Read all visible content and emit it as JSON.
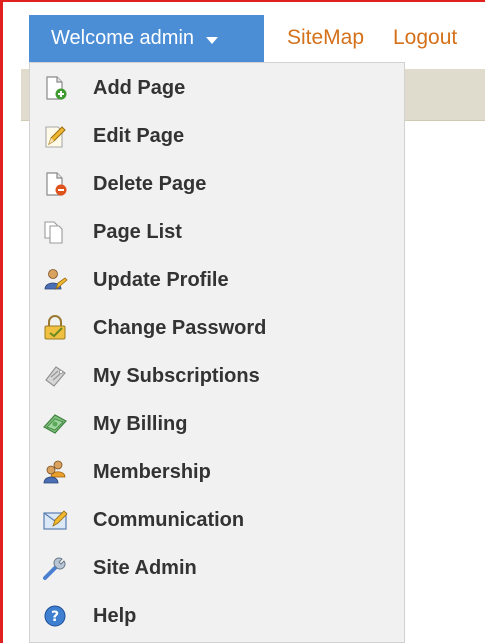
{
  "header": {
    "welcome_label": "Welcome admin",
    "sitemap_label": "SiteMap",
    "logout_label": "Logout"
  },
  "menu": {
    "items": [
      {
        "label": "Add Page",
        "icon": "add-page-icon"
      },
      {
        "label": "Edit Page",
        "icon": "edit-page-icon"
      },
      {
        "label": "Delete Page",
        "icon": "delete-page-icon"
      },
      {
        "label": "Page List",
        "icon": "page-list-icon"
      },
      {
        "label": "Update Profile",
        "icon": "update-profile-icon"
      },
      {
        "label": "Change Password",
        "icon": "change-password-icon"
      },
      {
        "label": "My Subscriptions",
        "icon": "subscriptions-icon"
      },
      {
        "label": "My Billing",
        "icon": "billing-icon"
      },
      {
        "label": "Membership",
        "icon": "membership-icon"
      },
      {
        "label": "Communication",
        "icon": "communication-icon"
      },
      {
        "label": "Site Admin",
        "icon": "site-admin-icon"
      },
      {
        "label": "Help",
        "icon": "help-icon"
      }
    ]
  },
  "colors": {
    "accent_blue": "#4b8ed6",
    "link_orange": "#d4711a",
    "frame_red": "#e12020",
    "menu_bg": "#f1f1f1"
  }
}
